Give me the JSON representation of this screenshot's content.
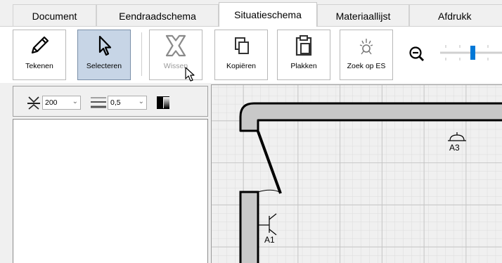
{
  "tabs": [
    {
      "label": "Document",
      "active": false
    },
    {
      "label": "Eendraadschema",
      "active": false
    },
    {
      "label": "Situatieschema",
      "active": true
    },
    {
      "label": "Materiaallijst",
      "active": false
    },
    {
      "label": "Afdrukk",
      "active": false
    }
  ],
  "toolbar": {
    "draw_label": "Tekenen",
    "select_label": "Selecteren",
    "delete_label": "Wissen",
    "copy_label": "Kopiëren",
    "paste_label": "Plakken",
    "search_label": "Zoek op ES"
  },
  "panel": {
    "size_value": "200",
    "thickness_value": "0,5"
  },
  "canvas": {
    "symbols": [
      {
        "label": "A3"
      },
      {
        "label": "A1"
      }
    ]
  },
  "colors": {
    "selected_button": "#c7d5e6",
    "wall_fill": "#c8c8c8",
    "grid_line": "#dcdcdc"
  }
}
